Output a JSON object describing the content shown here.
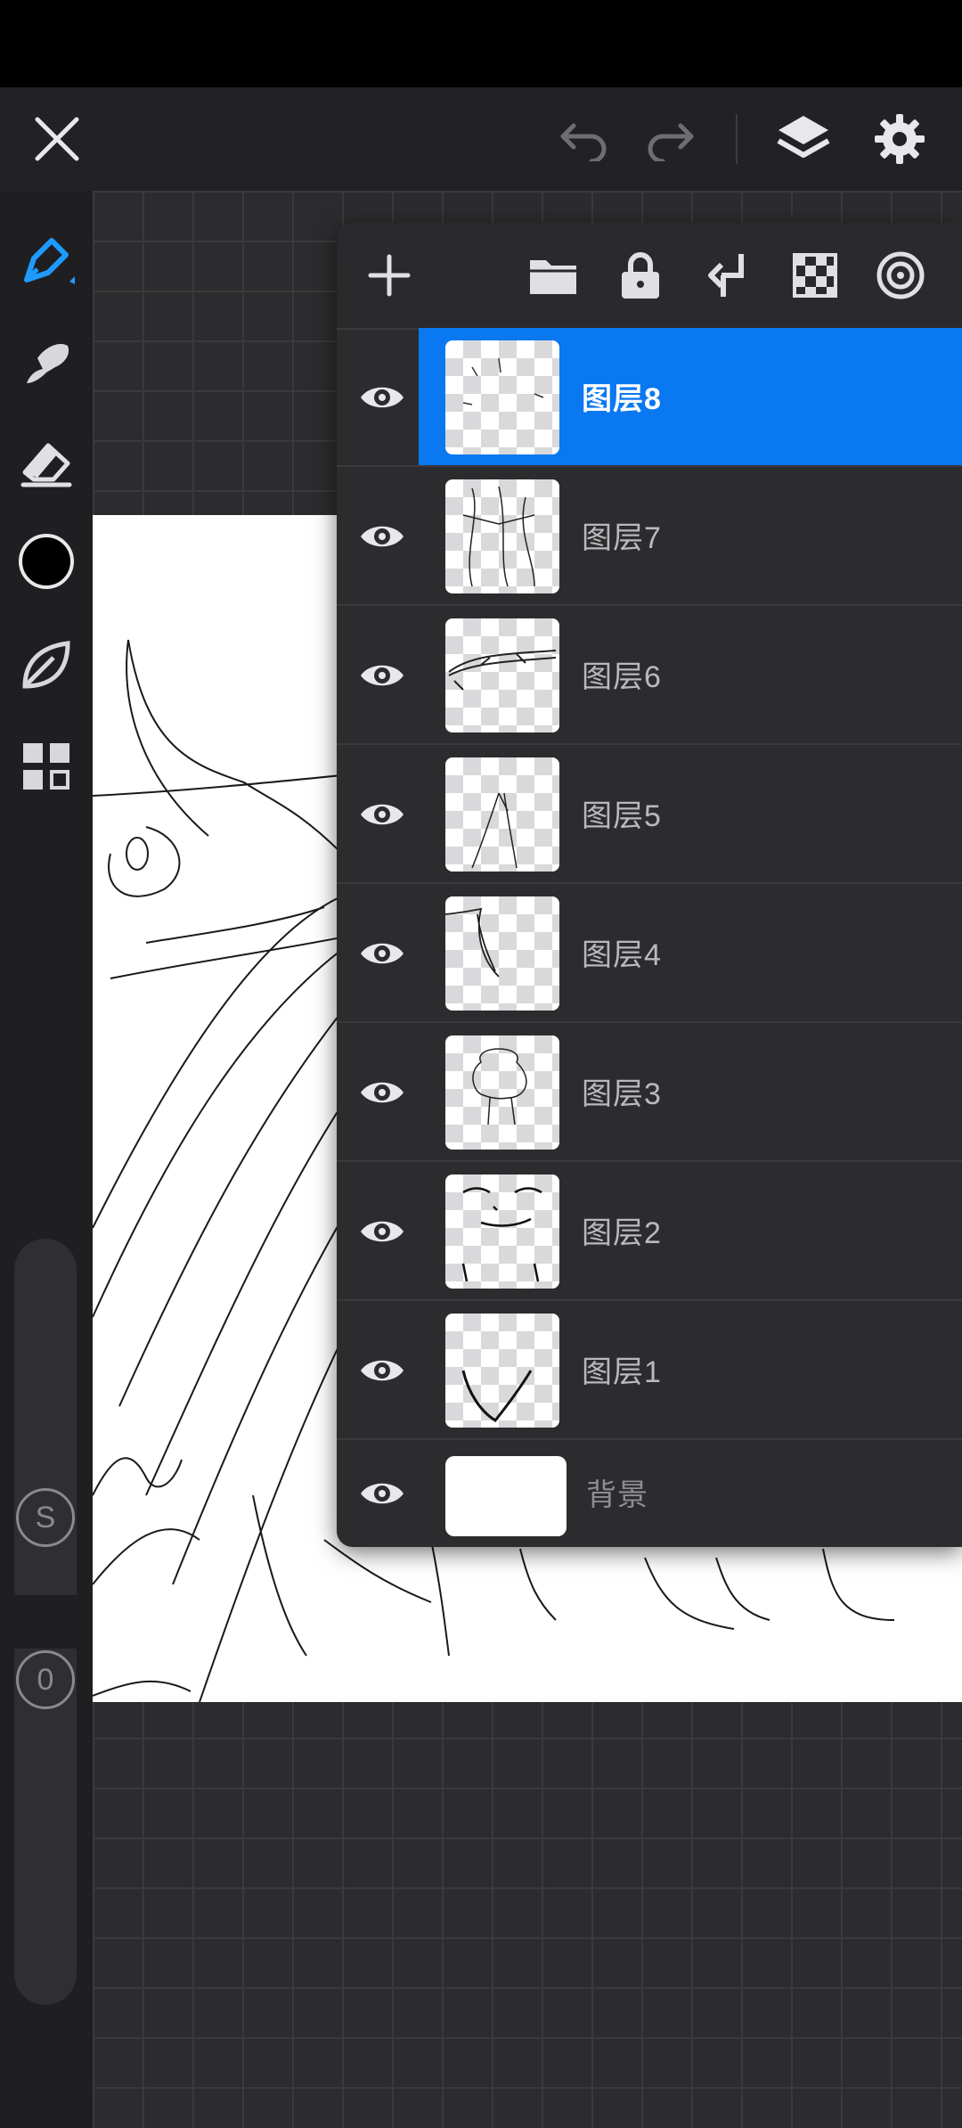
{
  "top_bar": {
    "close": "close-icon",
    "undo": "undo-icon",
    "redo": "redo-icon",
    "layers": "layers-icon",
    "settings": "gear-icon"
  },
  "tools": [
    "pen-icon",
    "smudge-icon",
    "eraser-icon",
    "color-swatch",
    "leaf-icon",
    "grid-icon"
  ],
  "color": "#000000",
  "accent": "#0a78f0",
  "slider_labels": {
    "size": "S",
    "opacity": "0"
  },
  "layers_panel": {
    "toolbar": [
      "add-icon",
      "folder-icon",
      "lock-icon",
      "merge-down-icon",
      "checker-icon",
      "target-icon"
    ],
    "layers": [
      {
        "name": "图层8",
        "visible": true,
        "selected": true
      },
      {
        "name": "图层7",
        "visible": true,
        "selected": false
      },
      {
        "name": "图层6",
        "visible": true,
        "selected": false
      },
      {
        "name": "图层5",
        "visible": true,
        "selected": false
      },
      {
        "name": "图层4",
        "visible": true,
        "selected": false
      },
      {
        "name": "图层3",
        "visible": true,
        "selected": false
      },
      {
        "name": "图层2",
        "visible": true,
        "selected": false
      },
      {
        "name": "图层1",
        "visible": true,
        "selected": false
      }
    ],
    "background": {
      "name": "背景",
      "visible": true
    }
  }
}
